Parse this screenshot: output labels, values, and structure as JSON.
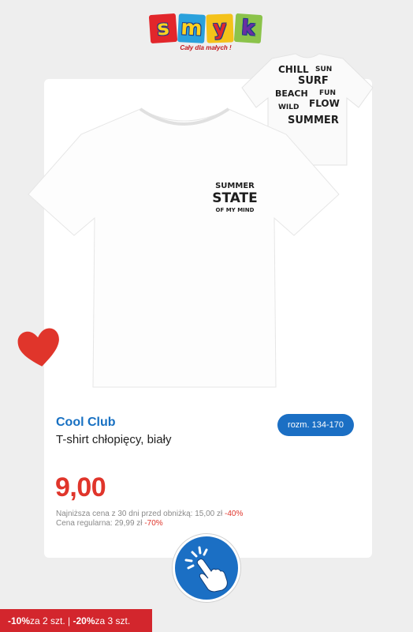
{
  "logo": {
    "letters": [
      "s",
      "m",
      "y",
      "k"
    ],
    "tagline": "Cały dla małych !"
  },
  "product": {
    "brand": "Cool Club",
    "title": "T-shirt chłopięcy, biały",
    "size_label": "rozm. 134-170",
    "price": "9,00",
    "lowest_price_text": "Najniższa cena z 30 dni przed obniżką: 15,00 zł",
    "lowest_price_discount": "-40%",
    "regular_price_text": "Cena regularna: 29,99 zł",
    "regular_price_discount": "-70%"
  },
  "print_front": [
    "SUMMER",
    "STATE",
    "OF MY MIND"
  ],
  "print_back": [
    "CHILL",
    "SUN",
    "SURF",
    "BEACH",
    "FUN",
    "WILD",
    "FLOW",
    "SUM",
    "MER"
  ],
  "promo": {
    "part1_bold": "-10%",
    "part1_rest": " za 2 szt.",
    "separator": " | ",
    "part2_bold": "-20%",
    "part2_rest": " za 3 szt."
  },
  "colors": {
    "brand_blue": "#1770c2",
    "price_red": "#e0352b",
    "promo_red": "#d3262d"
  },
  "icons": [
    "heart-icon",
    "tap-hand-icon"
  ]
}
